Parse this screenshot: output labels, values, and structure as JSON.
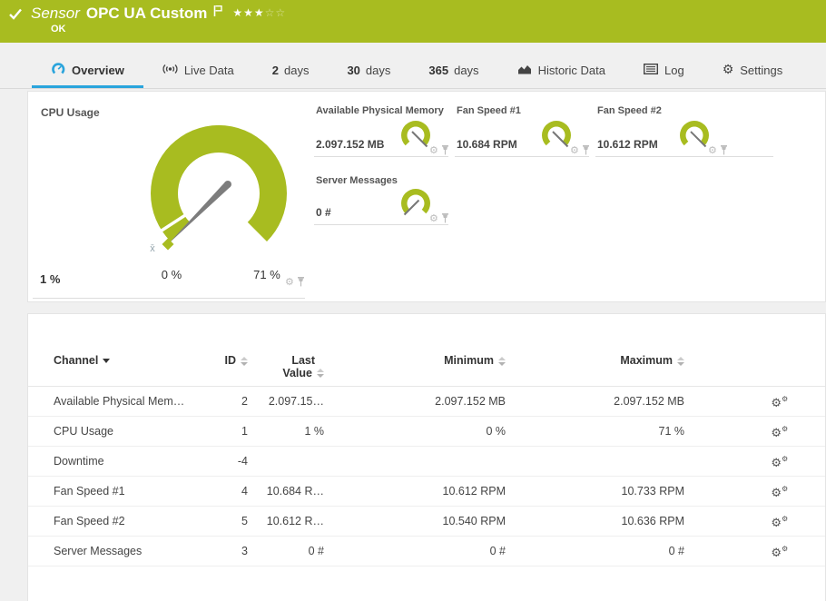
{
  "colors": {
    "brand_green": "#a8bc20",
    "accent_blue": "#2aa4dc",
    "needle_gray": "#7d7d7d"
  },
  "header": {
    "kind_label": "Sensor",
    "title": "OPC UA Custom",
    "status": "OK",
    "stars_filled": "★★★",
    "stars_empty": "☆☆"
  },
  "tabs": [
    {
      "icon": "gauge-icon",
      "label": "Overview",
      "active": true
    },
    {
      "icon": "live-data-icon",
      "label": "Live Data"
    },
    {
      "num": "2",
      "label": "days"
    },
    {
      "num": "30",
      "label": "days"
    },
    {
      "num": "365",
      "label": "days"
    },
    {
      "icon": "historic-data-icon",
      "label": "Historic Data"
    },
    {
      "icon": "log-icon",
      "label": "Log"
    },
    {
      "icon": "settings-icon",
      "label": "Settings"
    }
  ],
  "gauges": {
    "main": {
      "title": "CPU Usage",
      "value": "1 %",
      "min_label": "0 %",
      "max_label": "71 %",
      "mean_marker": "x̄"
    },
    "small": [
      {
        "title": "Available Physical Memory",
        "value": "2.097.152 MB"
      },
      {
        "title": "Fan Speed #1",
        "value": "10.684 RPM"
      },
      {
        "title": "Fan Speed #2",
        "value": "10.612 RPM"
      },
      {
        "title": "Server Messages",
        "value": "0 #"
      }
    ]
  },
  "table": {
    "headers": {
      "channel": "Channel",
      "id": "ID",
      "last1": "Last",
      "last2": "Value",
      "min": "Minimum",
      "max": "Maximum"
    },
    "rows": [
      {
        "channel": "Available Physical Mem…",
        "id": "2",
        "last": "2.097.15…",
        "min": "2.097.152 MB",
        "max": "2.097.152 MB"
      },
      {
        "channel": "CPU Usage",
        "id": "1",
        "last": "1 %",
        "min": "0 %",
        "max": "71 %"
      },
      {
        "channel": "Downtime",
        "id": "-4",
        "last": "",
        "min": "",
        "max": ""
      },
      {
        "channel": "Fan Speed #1",
        "id": "4",
        "last": "10.684 R…",
        "min": "10.612 RPM",
        "max": "10.733 RPM"
      },
      {
        "channel": "Fan Speed #2",
        "id": "5",
        "last": "10.612 R…",
        "min": "10.540 RPM",
        "max": "10.636 RPM"
      },
      {
        "channel": "Server Messages",
        "id": "3",
        "last": "0 #",
        "min": "0 #",
        "max": "0 #"
      }
    ]
  }
}
